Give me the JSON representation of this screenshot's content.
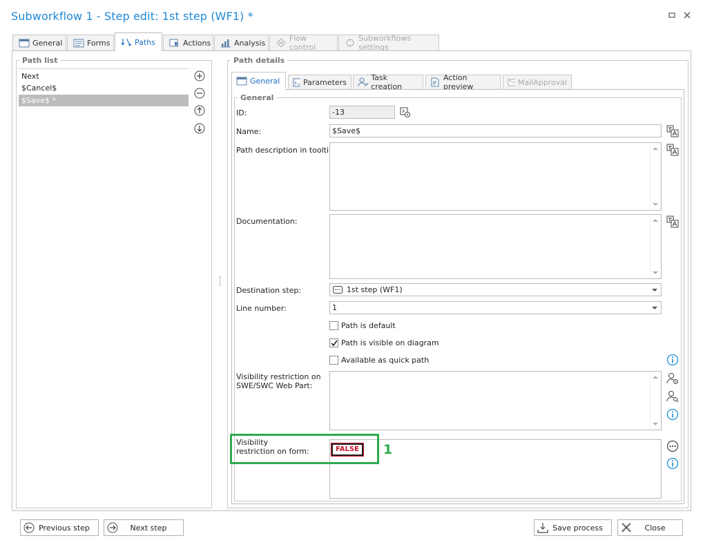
{
  "window": {
    "title": "Subworkflow 1 - Step edit: 1st step (WF1) *",
    "minimize_glyph": "▫",
    "close_glyph": "✕"
  },
  "main_tabs": [
    {
      "label": "General",
      "icon": "window-icon",
      "active": false,
      "disabled": false
    },
    {
      "label": "Forms",
      "icon": "form-icon",
      "active": false,
      "disabled": false
    },
    {
      "label": "Paths",
      "icon": "paths-icon",
      "active": true,
      "disabled": false
    },
    {
      "label": "Actions",
      "icon": "actions-icon",
      "active": false,
      "disabled": false
    },
    {
      "label": "Analysis",
      "icon": "chart-icon",
      "active": false,
      "disabled": false
    },
    {
      "label": "Flow control",
      "icon": "flow-control-icon",
      "active": false,
      "disabled": true
    },
    {
      "label": "Subworkflows settings",
      "icon": "subworkflow-icon",
      "active": false,
      "disabled": true
    }
  ],
  "path_list": {
    "legend": "Path list",
    "items": [
      {
        "label": "Next",
        "selected": false
      },
      {
        "label": "$Cancel$",
        "selected": false
      },
      {
        "label": "$Save$ *",
        "selected": true
      }
    ]
  },
  "path_details": {
    "legend": "Path details",
    "tabs": [
      {
        "label": "General",
        "active": true,
        "disabled": false
      },
      {
        "label": "Parameters",
        "active": false,
        "disabled": false
      },
      {
        "label": "Task creation",
        "active": false,
        "disabled": false
      },
      {
        "label": "Action preview",
        "active": false,
        "disabled": false
      },
      {
        "label": "MailApproval",
        "active": false,
        "disabled": true
      }
    ],
    "general": {
      "legend": "General",
      "id_label": "ID:",
      "id_value": "-13",
      "name_label": "Name:",
      "name_value": "$Save$",
      "tooltip_label": "Path description in tooltip:",
      "documentation_label": "Documentation:",
      "destination_label": "Destination step:",
      "destination_value": "1st step (WF1)",
      "line_number_label": "Line number:",
      "line_number_value": "1",
      "path_is_default_label": "Path is default",
      "path_is_default_checked": false,
      "visible_on_diagram_label": "Path is visible on diagram",
      "visible_on_diagram_checked": true,
      "quick_path_label": "Available as quick path",
      "quick_path_checked": false,
      "visibility_swe_label_1": "Visibility restriction on",
      "visibility_swe_label_2": "SWE/SWC Web Part:",
      "visibility_form_label_1": "Visibility",
      "visibility_form_label_2": "restriction on form:",
      "visibility_form_value": "FALSE"
    }
  },
  "callout_number": "1",
  "footer": {
    "previous_step": "Previous step",
    "next_step": "Next step",
    "save_process": "Save process",
    "close": "Close"
  },
  "colors": {
    "title": "#1f8ad6",
    "active_tab_text": "#1f6fbf",
    "highlight": "#2eaa4f",
    "false_badge": "#c8142c",
    "info_icon": "#1a8fd6"
  }
}
